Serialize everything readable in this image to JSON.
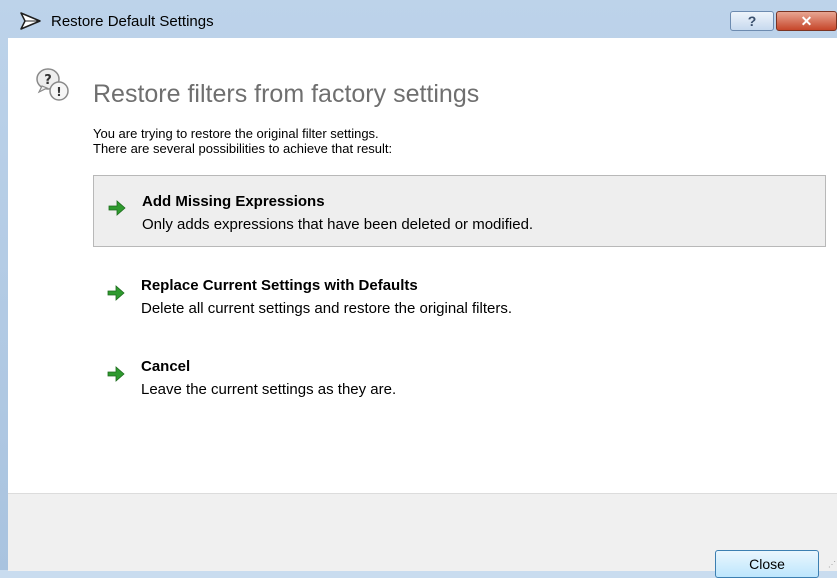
{
  "window": {
    "title": "Restore Default Settings",
    "help_label": "?",
    "close_label": "✕"
  },
  "header": {
    "title": "Restore filters from factory settings"
  },
  "intro": {
    "line1": "You are trying to restore the original filter settings.",
    "line2": "There are several possibilities to achieve that result:"
  },
  "options": [
    {
      "title": "Add Missing Expressions",
      "description": "Only adds expressions that have been deleted or modified.",
      "highlighted": true
    },
    {
      "title": "Replace Current Settings with Defaults",
      "description": "Delete all current settings and restore the original filters.",
      "highlighted": false
    },
    {
      "title": "Cancel",
      "description": "Leave the current settings as they are.",
      "highlighted": false
    }
  ],
  "footer": {
    "close_label": "Close"
  },
  "icons": {
    "window": "app-arrow-icon",
    "header": "question-warning-icon",
    "option": "green-arrow-icon"
  },
  "colors": {
    "title_bar": "#bdd3ea",
    "header_text": "#6f6f6f",
    "option_arrow": "#2e9a2e",
    "selected_option_bg": "#eeeeee",
    "footer_bg": "#f0f0f0"
  }
}
